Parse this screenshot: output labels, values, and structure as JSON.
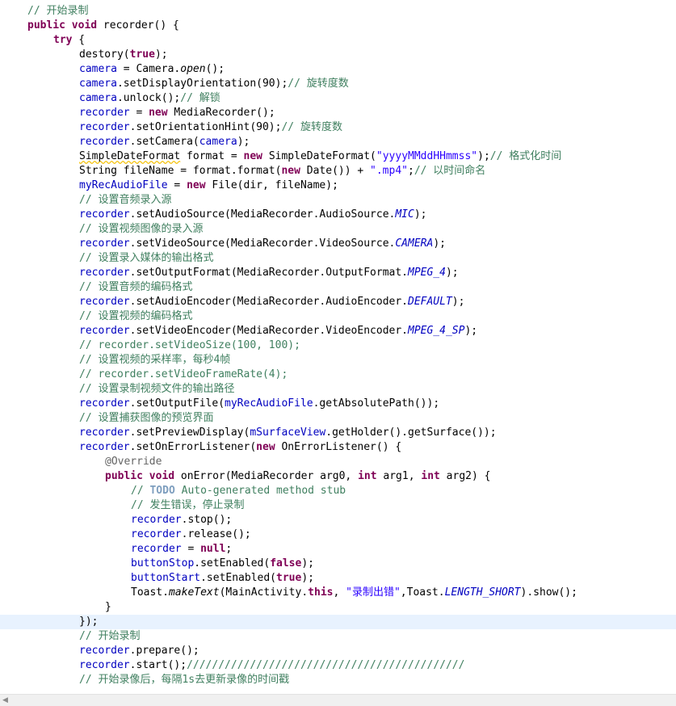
{
  "editor": {
    "lines": [
      {
        "indent": 4,
        "tokens": [
          {
            "t": "// 开始录制",
            "c": "cm"
          }
        ]
      },
      {
        "indent": 4,
        "tokens": [
          {
            "t": "public",
            "c": "kw"
          },
          {
            "t": " "
          },
          {
            "t": "void",
            "c": "kw"
          },
          {
            "t": " recorder() {"
          }
        ]
      },
      {
        "indent": 8,
        "tokens": [
          {
            "t": "try",
            "c": "kw"
          },
          {
            "t": " {"
          }
        ]
      },
      {
        "indent": 12,
        "tokens": [
          {
            "t": "destory("
          },
          {
            "t": "true",
            "c": "kw"
          },
          {
            "t": ");"
          }
        ]
      },
      {
        "indent": 12,
        "tokens": [
          {
            "t": "camera",
            "c": "fld"
          },
          {
            "t": " = Camera."
          },
          {
            "t": "open",
            "c": "it"
          },
          {
            "t": "();"
          }
        ]
      },
      {
        "indent": 12,
        "tokens": [
          {
            "t": "camera",
            "c": "fld"
          },
          {
            "t": ".setDisplayOrientation(90);"
          },
          {
            "t": "// 旋转度数",
            "c": "cm"
          }
        ]
      },
      {
        "indent": 12,
        "tokens": [
          {
            "t": "camera",
            "c": "fld"
          },
          {
            "t": ".unlock();"
          },
          {
            "t": "// 解锁",
            "c": "cm"
          }
        ]
      },
      {
        "indent": 12,
        "tokens": [
          {
            "t": "recorder",
            "c": "fld"
          },
          {
            "t": " = "
          },
          {
            "t": "new",
            "c": "kw"
          },
          {
            "t": " MediaRecorder();"
          }
        ]
      },
      {
        "indent": 12,
        "tokens": [
          {
            "t": "recorder",
            "c": "fld"
          },
          {
            "t": ".setOrientationHint(90);"
          },
          {
            "t": "// 旋转度数",
            "c": "cm"
          }
        ]
      },
      {
        "indent": 12,
        "tokens": [
          {
            "t": "recorder",
            "c": "fld"
          },
          {
            "t": ".setCamera("
          },
          {
            "t": "camera",
            "c": "fld"
          },
          {
            "t": ");"
          }
        ]
      },
      {
        "indent": 12,
        "tokens": [
          {
            "t": "SimpleDateFormat",
            "c": "warn"
          },
          {
            "t": " format = "
          },
          {
            "t": "new",
            "c": "kw"
          },
          {
            "t": " SimpleDateFormat("
          },
          {
            "t": "\"yyyyMMddHHmmss\"",
            "c": "str"
          },
          {
            "t": ");"
          },
          {
            "t": "// 格式化时间",
            "c": "cm"
          }
        ]
      },
      {
        "indent": 12,
        "tokens": [
          {
            "t": "String fileName = format.format("
          },
          {
            "t": "new",
            "c": "kw"
          },
          {
            "t": " Date()) + "
          },
          {
            "t": "\".mp4\"",
            "c": "str"
          },
          {
            "t": ";"
          },
          {
            "t": "// 以时间命名",
            "c": "cm"
          }
        ]
      },
      {
        "indent": 12,
        "tokens": [
          {
            "t": "myRecAudioFile",
            "c": "fld"
          },
          {
            "t": " = "
          },
          {
            "t": "new",
            "c": "kw"
          },
          {
            "t": " File(dir, fileName);"
          }
        ]
      },
      {
        "indent": 12,
        "tokens": [
          {
            "t": "// 设置音频录入源",
            "c": "cm"
          }
        ]
      },
      {
        "indent": 12,
        "tokens": [
          {
            "t": "recorder",
            "c": "fld"
          },
          {
            "t": ".setAudioSource(MediaRecorder.AudioSource."
          },
          {
            "t": "MIC",
            "c": "sf"
          },
          {
            "t": ");"
          }
        ]
      },
      {
        "indent": 12,
        "tokens": [
          {
            "t": "// 设置视频图像的录入源",
            "c": "cm"
          }
        ]
      },
      {
        "indent": 12,
        "tokens": [
          {
            "t": "recorder",
            "c": "fld"
          },
          {
            "t": ".setVideoSource(MediaRecorder.VideoSource."
          },
          {
            "t": "CAMERA",
            "c": "sf"
          },
          {
            "t": ");"
          }
        ]
      },
      {
        "indent": 12,
        "tokens": [
          {
            "t": "// 设置录入媒体的输出格式",
            "c": "cm"
          }
        ]
      },
      {
        "indent": 12,
        "tokens": [
          {
            "t": "recorder",
            "c": "fld"
          },
          {
            "t": ".setOutputFormat(MediaRecorder.OutputFormat."
          },
          {
            "t": "MPEG_4",
            "c": "sf"
          },
          {
            "t": ");"
          }
        ]
      },
      {
        "indent": 12,
        "tokens": [
          {
            "t": "// 设置音频的编码格式",
            "c": "cm"
          }
        ]
      },
      {
        "indent": 12,
        "tokens": [
          {
            "t": "recorder",
            "c": "fld"
          },
          {
            "t": ".setAudioEncoder(MediaRecorder.AudioEncoder."
          },
          {
            "t": "DEFAULT",
            "c": "sf"
          },
          {
            "t": ");"
          }
        ]
      },
      {
        "indent": 12,
        "tokens": [
          {
            "t": "// 设置视频的编码格式",
            "c": "cm"
          }
        ]
      },
      {
        "indent": 12,
        "tokens": [
          {
            "t": "recorder",
            "c": "fld"
          },
          {
            "t": ".setVideoEncoder(MediaRecorder.VideoEncoder."
          },
          {
            "t": "MPEG_4_SP",
            "c": "sf"
          },
          {
            "t": ");"
          }
        ]
      },
      {
        "indent": 12,
        "tokens": [
          {
            "t": "// recorder.setVideoSize(100, 100);",
            "c": "cm"
          }
        ]
      },
      {
        "indent": 12,
        "tokens": [
          {
            "t": "// 设置视频的采样率，每秒4帧",
            "c": "cm"
          }
        ]
      },
      {
        "indent": 12,
        "tokens": [
          {
            "t": "// recorder.setVideoFrameRate(4);",
            "c": "cm"
          }
        ]
      },
      {
        "indent": 12,
        "tokens": [
          {
            "t": "// 设置录制视频文件的输出路径",
            "c": "cm"
          }
        ]
      },
      {
        "indent": 12,
        "tokens": [
          {
            "t": "recorder",
            "c": "fld"
          },
          {
            "t": ".setOutputFile("
          },
          {
            "t": "myRecAudioFile",
            "c": "fld"
          },
          {
            "t": ".getAbsolutePath());"
          }
        ]
      },
      {
        "indent": 12,
        "tokens": [
          {
            "t": "// 设置捕获图像的预览界面",
            "c": "cm"
          }
        ]
      },
      {
        "indent": 12,
        "tokens": [
          {
            "t": "recorder",
            "c": "fld"
          },
          {
            "t": ".setPreviewDisplay("
          },
          {
            "t": "mSurfaceView",
            "c": "fld"
          },
          {
            "t": ".getHolder().getSurface());"
          }
        ]
      },
      {
        "indent": 12,
        "tokens": [
          {
            "t": "recorder",
            "c": "fld"
          },
          {
            "t": ".setOnErrorListener("
          },
          {
            "t": "new",
            "c": "kw"
          },
          {
            "t": " OnErrorListener() {"
          }
        ]
      },
      {
        "indent": 16,
        "tokens": [
          {
            "t": "@Override",
            "c": "ann"
          }
        ]
      },
      {
        "indent": 16,
        "tokens": [
          {
            "t": "public",
            "c": "kw"
          },
          {
            "t": " "
          },
          {
            "t": "void",
            "c": "kw"
          },
          {
            "t": " onError(MediaRecorder arg0, "
          },
          {
            "t": "int",
            "c": "kw"
          },
          {
            "t": " arg1, "
          },
          {
            "t": "int",
            "c": "kw"
          },
          {
            "t": " arg2) {"
          }
        ]
      },
      {
        "indent": 20,
        "tokens": [
          {
            "t": "// ",
            "c": "cm"
          },
          {
            "t": "TODO",
            "c": "todo"
          },
          {
            "t": " Auto-generated method stub",
            "c": "cm"
          }
        ]
      },
      {
        "indent": 20,
        "tokens": [
          {
            "t": "// 发生错误，停止录制",
            "c": "cm"
          }
        ]
      },
      {
        "indent": 20,
        "tokens": [
          {
            "t": "recorder",
            "c": "fld"
          },
          {
            "t": ".stop();"
          }
        ]
      },
      {
        "indent": 20,
        "tokens": [
          {
            "t": "recorder",
            "c": "fld"
          },
          {
            "t": ".release();"
          }
        ]
      },
      {
        "indent": 20,
        "tokens": [
          {
            "t": "recorder",
            "c": "fld"
          },
          {
            "t": " = "
          },
          {
            "t": "null",
            "c": "kw"
          },
          {
            "t": ";"
          }
        ]
      },
      {
        "indent": 20,
        "tokens": [
          {
            "t": "buttonStop",
            "c": "fld"
          },
          {
            "t": ".setEnabled("
          },
          {
            "t": "false",
            "c": "kw"
          },
          {
            "t": ");"
          }
        ]
      },
      {
        "indent": 20,
        "tokens": [
          {
            "t": "buttonStart",
            "c": "fld"
          },
          {
            "t": ".setEnabled("
          },
          {
            "t": "true",
            "c": "kw"
          },
          {
            "t": ");"
          }
        ]
      },
      {
        "indent": 20,
        "tokens": [
          {
            "t": "Toast."
          },
          {
            "t": "makeText",
            "c": "it"
          },
          {
            "t": "(MainActivity."
          },
          {
            "t": "this",
            "c": "kw"
          },
          {
            "t": ", "
          },
          {
            "t": "\"录制出错\"",
            "c": "str"
          },
          {
            "t": ",Toast."
          },
          {
            "t": "LENGTH_SHORT",
            "c": "sf"
          },
          {
            "t": ").show();"
          }
        ]
      },
      {
        "indent": 16,
        "tokens": [
          {
            "t": "}"
          }
        ]
      },
      {
        "indent": 12,
        "tokens": [
          {
            "t": "});"
          }
        ],
        "current": true
      },
      {
        "indent": 12,
        "tokens": [
          {
            "t": "// 开始录制",
            "c": "cm"
          }
        ]
      },
      {
        "indent": 12,
        "tokens": [
          {
            "t": "recorder",
            "c": "fld"
          },
          {
            "t": ".prepare();"
          }
        ]
      },
      {
        "indent": 12,
        "tokens": [
          {
            "t": "recorder",
            "c": "fld"
          },
          {
            "t": ".start();"
          },
          {
            "t": "////////////////////////////////////////////",
            "c": "cm"
          }
        ]
      },
      {
        "indent": 12,
        "tokens": [
          {
            "t": "// 开始录像后，每隔1s去更新录像的时间戳",
            "c": "cm"
          }
        ]
      }
    ]
  },
  "scrollbar": {
    "left_arrow": "◀"
  }
}
